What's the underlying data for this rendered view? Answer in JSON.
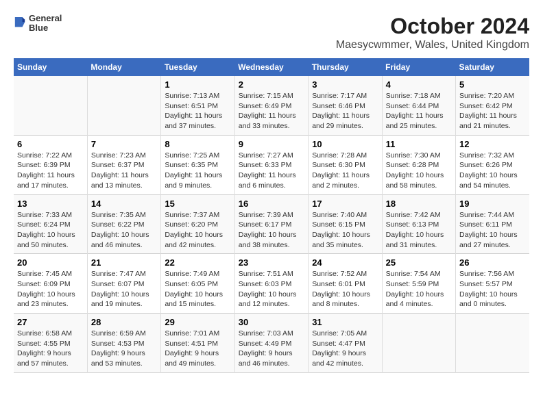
{
  "header": {
    "logo_line1": "General",
    "logo_line2": "Blue",
    "title": "October 2024",
    "subtitle": "Maesycwmmer, Wales, United Kingdom"
  },
  "days_of_week": [
    "Sunday",
    "Monday",
    "Tuesday",
    "Wednesday",
    "Thursday",
    "Friday",
    "Saturday"
  ],
  "weeks": [
    [
      {
        "day": "",
        "info": ""
      },
      {
        "day": "",
        "info": ""
      },
      {
        "day": "1",
        "info": "Sunrise: 7:13 AM\nSunset: 6:51 PM\nDaylight: 11 hours and 37 minutes."
      },
      {
        "day": "2",
        "info": "Sunrise: 7:15 AM\nSunset: 6:49 PM\nDaylight: 11 hours and 33 minutes."
      },
      {
        "day": "3",
        "info": "Sunrise: 7:17 AM\nSunset: 6:46 PM\nDaylight: 11 hours and 29 minutes."
      },
      {
        "day": "4",
        "info": "Sunrise: 7:18 AM\nSunset: 6:44 PM\nDaylight: 11 hours and 25 minutes."
      },
      {
        "day": "5",
        "info": "Sunrise: 7:20 AM\nSunset: 6:42 PM\nDaylight: 11 hours and 21 minutes."
      }
    ],
    [
      {
        "day": "6",
        "info": "Sunrise: 7:22 AM\nSunset: 6:39 PM\nDaylight: 11 hours and 17 minutes."
      },
      {
        "day": "7",
        "info": "Sunrise: 7:23 AM\nSunset: 6:37 PM\nDaylight: 11 hours and 13 minutes."
      },
      {
        "day": "8",
        "info": "Sunrise: 7:25 AM\nSunset: 6:35 PM\nDaylight: 11 hours and 9 minutes."
      },
      {
        "day": "9",
        "info": "Sunrise: 7:27 AM\nSunset: 6:33 PM\nDaylight: 11 hours and 6 minutes."
      },
      {
        "day": "10",
        "info": "Sunrise: 7:28 AM\nSunset: 6:30 PM\nDaylight: 11 hours and 2 minutes."
      },
      {
        "day": "11",
        "info": "Sunrise: 7:30 AM\nSunset: 6:28 PM\nDaylight: 10 hours and 58 minutes."
      },
      {
        "day": "12",
        "info": "Sunrise: 7:32 AM\nSunset: 6:26 PM\nDaylight: 10 hours and 54 minutes."
      }
    ],
    [
      {
        "day": "13",
        "info": "Sunrise: 7:33 AM\nSunset: 6:24 PM\nDaylight: 10 hours and 50 minutes."
      },
      {
        "day": "14",
        "info": "Sunrise: 7:35 AM\nSunset: 6:22 PM\nDaylight: 10 hours and 46 minutes."
      },
      {
        "day": "15",
        "info": "Sunrise: 7:37 AM\nSunset: 6:20 PM\nDaylight: 10 hours and 42 minutes."
      },
      {
        "day": "16",
        "info": "Sunrise: 7:39 AM\nSunset: 6:17 PM\nDaylight: 10 hours and 38 minutes."
      },
      {
        "day": "17",
        "info": "Sunrise: 7:40 AM\nSunset: 6:15 PM\nDaylight: 10 hours and 35 minutes."
      },
      {
        "day": "18",
        "info": "Sunrise: 7:42 AM\nSunset: 6:13 PM\nDaylight: 10 hours and 31 minutes."
      },
      {
        "day": "19",
        "info": "Sunrise: 7:44 AM\nSunset: 6:11 PM\nDaylight: 10 hours and 27 minutes."
      }
    ],
    [
      {
        "day": "20",
        "info": "Sunrise: 7:45 AM\nSunset: 6:09 PM\nDaylight: 10 hours and 23 minutes."
      },
      {
        "day": "21",
        "info": "Sunrise: 7:47 AM\nSunset: 6:07 PM\nDaylight: 10 hours and 19 minutes."
      },
      {
        "day": "22",
        "info": "Sunrise: 7:49 AM\nSunset: 6:05 PM\nDaylight: 10 hours and 15 minutes."
      },
      {
        "day": "23",
        "info": "Sunrise: 7:51 AM\nSunset: 6:03 PM\nDaylight: 10 hours and 12 minutes."
      },
      {
        "day": "24",
        "info": "Sunrise: 7:52 AM\nSunset: 6:01 PM\nDaylight: 10 hours and 8 minutes."
      },
      {
        "day": "25",
        "info": "Sunrise: 7:54 AM\nSunset: 5:59 PM\nDaylight: 10 hours and 4 minutes."
      },
      {
        "day": "26",
        "info": "Sunrise: 7:56 AM\nSunset: 5:57 PM\nDaylight: 10 hours and 0 minutes."
      }
    ],
    [
      {
        "day": "27",
        "info": "Sunrise: 6:58 AM\nSunset: 4:55 PM\nDaylight: 9 hours and 57 minutes."
      },
      {
        "day": "28",
        "info": "Sunrise: 6:59 AM\nSunset: 4:53 PM\nDaylight: 9 hours and 53 minutes."
      },
      {
        "day": "29",
        "info": "Sunrise: 7:01 AM\nSunset: 4:51 PM\nDaylight: 9 hours and 49 minutes."
      },
      {
        "day": "30",
        "info": "Sunrise: 7:03 AM\nSunset: 4:49 PM\nDaylight: 9 hours and 46 minutes."
      },
      {
        "day": "31",
        "info": "Sunrise: 7:05 AM\nSunset: 4:47 PM\nDaylight: 9 hours and 42 minutes."
      },
      {
        "day": "",
        "info": ""
      },
      {
        "day": "",
        "info": ""
      }
    ]
  ]
}
